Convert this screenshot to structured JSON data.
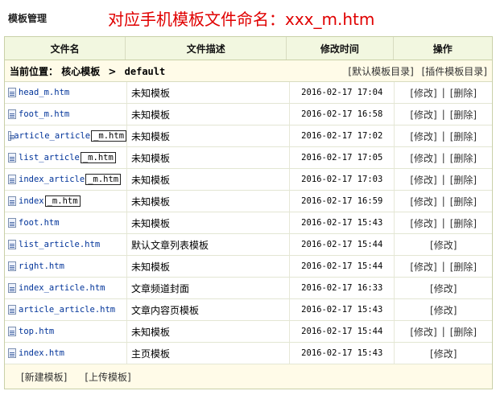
{
  "panel": {
    "title": "模板管理",
    "annotation": "对应手机模板文件命名：xxx_m.htm"
  },
  "table": {
    "headers": [
      "文件名",
      "文件描述",
      "修改时间",
      "操作"
    ],
    "location": {
      "prefix": "当前位置：",
      "root": "核心模板",
      "separator": ">",
      "current": "default"
    },
    "top_links": [
      "[默认模板目录]",
      "[插件模板目录]"
    ],
    "rows": [
      {
        "name": "head_m.htm",
        "desc": "未知模板",
        "time": "2016-02-17 17:04",
        "edit": "[修改]",
        "sep": "|",
        "del": "[删除]"
      },
      {
        "name": "foot_m.htm",
        "desc": "未知模板",
        "time": "2016-02-17 16:58",
        "edit": "[修改]",
        "sep": "|",
        "del": "[删除]"
      },
      {
        "name": "article_article",
        "suffix": "_m.htm",
        "desc": "未知模板",
        "time": "2016-02-17 17:02",
        "edit": "[修改]",
        "sep": "|",
        "del": "[删除]"
      },
      {
        "name": "list_article",
        "suffix": "_m.htm",
        "desc": "未知模板",
        "time": "2016-02-17 17:05",
        "edit": "[修改]",
        "sep": "|",
        "del": "[删除]"
      },
      {
        "name": "index_article",
        "suffix": "_m.htm",
        "desc": "未知模板",
        "time": "2016-02-17 17:03",
        "edit": "[修改]",
        "sep": "|",
        "del": "[删除]"
      },
      {
        "name": "index",
        "suffix": "_m.htm",
        "desc": "未知模板",
        "time": "2016-02-17 16:59",
        "edit": "[修改]",
        "sep": "|",
        "del": "[删除]"
      },
      {
        "name": "foot.htm",
        "desc": "未知模板",
        "time": "2016-02-17 15:43",
        "edit": "[修改]",
        "sep": "|",
        "del": "[删除]"
      },
      {
        "name": "list_article.htm",
        "desc": "默认文章列表模板",
        "time": "2016-02-17 15:44",
        "edit": "[修改]"
      },
      {
        "name": "right.htm",
        "desc": "未知模板",
        "time": "2016-02-17 15:44",
        "edit": "[修改]",
        "sep": "|",
        "del": "[删除]"
      },
      {
        "name": "index_article.htm",
        "desc": "文章频道封面",
        "time": "2016-02-17 16:33",
        "edit": "[修改]"
      },
      {
        "name": "article_article.htm",
        "desc": "文章内容页模板",
        "time": "2016-02-17 15:43",
        "edit": "[修改]"
      },
      {
        "name": "top.htm",
        "desc": "未知模板",
        "time": "2016-02-17 15:44",
        "edit": "[修改]",
        "sep": "|",
        "del": "[删除]"
      },
      {
        "name": "index.htm",
        "desc": "主页模板",
        "time": "2016-02-17 15:43",
        "edit": "[修改]"
      }
    ],
    "footer": {
      "new_label": "[新建模板]",
      "upload_label": "[上传模板]"
    }
  }
}
